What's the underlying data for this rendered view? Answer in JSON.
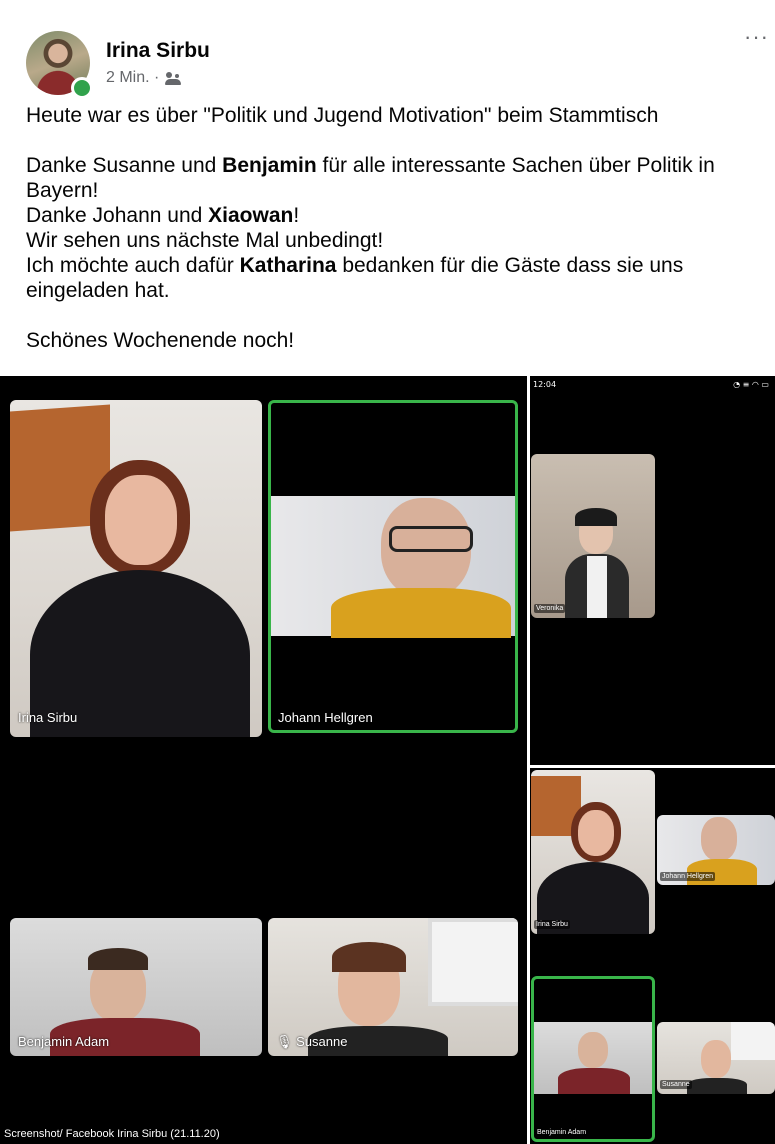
{
  "post": {
    "author": "Irina Sirbu",
    "time": "2 Min. ·",
    "audience_icon": "friends-icon",
    "more_label": "···",
    "lines": [
      "Heute war es über \"Politik und Jugend Motivation\" beim Stammtisch",
      "",
      "Danke Susanne und Benjamin für alle interessante Sachen über Politik in Bayern!",
      "Danke Johann und Xiaowan!",
      "Wir sehen uns nächste Mal unbedingt!",
      "Ich möchte auch dafür Katharina bedanken für die Gäste dass sie uns eingeladen hat.",
      "",
      "Schönes Wochenende noch!"
    ],
    "line1": "Heute war es über \"Politik und Jugend Motivation\" beim Stammtisch",
    "line2a": "Danke Susanne und ",
    "line2b": "Benjamin",
    "line2c": " für alle interessante Sachen über Politik in Bayern!",
    "line3a": "Danke Johann und ",
    "line3b": "Xiaowan",
    "line3c": "!",
    "line4": "Wir sehen uns nächste Mal unbedingt!",
    "line5a": "Ich möchte auch dafür ",
    "line5b": "Katharina",
    "line5c": " bedanken für die Gäste dass sie uns eingeladen hat.",
    "line6": "Schönes Wochenende noch!"
  },
  "call": {
    "participants": {
      "irina": "Irina Sirbu",
      "johann": "Johann Hellgren",
      "benjamin": "Benjamin Adam",
      "susanne": "Susanne",
      "veronika": "Veronika"
    },
    "phone_time": "12:04",
    "small_irina": "Irina Sirbu",
    "small_johann": "Johann Hellgren",
    "small_benjamin": "Benjamin Adam",
    "small_susanne": "Susanne"
  },
  "caption": "Screenshot/ Facebook Irina Sirbu (21.11.20)",
  "colors": {
    "active_border": "#39b54a",
    "online": "#31a24c"
  }
}
